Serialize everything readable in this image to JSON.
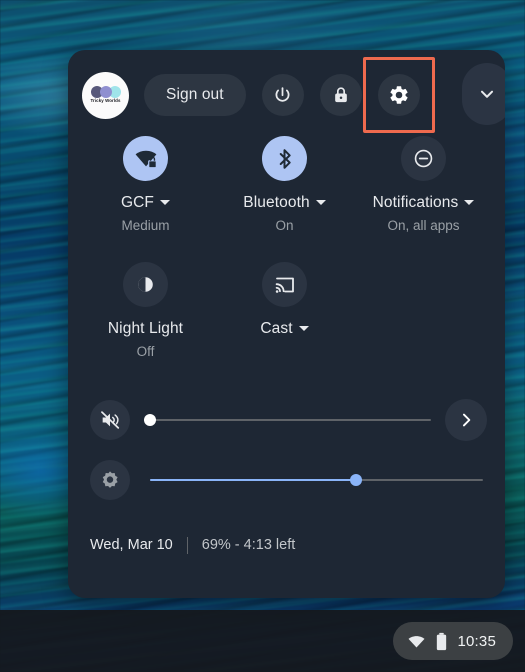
{
  "wallpaper": {
    "name": "peacock-feather-wallpaper",
    "dominant_colors": [
      "#0b5a80",
      "#0a5d6e",
      "#0d3f86"
    ]
  },
  "tray": {
    "background_color": "#1e2734",
    "header": {
      "avatar": {
        "name": "Tricky Worlds",
        "icon": "profile-avatar"
      },
      "sign_out_label": "Sign out",
      "buttons": [
        {
          "name": "power-button",
          "icon": "power-icon"
        },
        {
          "name": "lock-button",
          "icon": "lock-icon"
        },
        {
          "name": "settings-button",
          "icon": "gear-icon",
          "highlighted": true,
          "highlight_color": "#ef6a4e"
        }
      ],
      "collapse_icon": "chevron-down-icon"
    },
    "tiles": [
      {
        "id": "network",
        "icon": "wifi-locked-icon",
        "label": "GCF",
        "sublabel": "Medium",
        "has_caret": true,
        "active": true
      },
      {
        "id": "bluetooth",
        "icon": "bluetooth-icon",
        "label": "Bluetooth",
        "sublabel": "On",
        "has_caret": true,
        "active": true
      },
      {
        "id": "notifications",
        "icon": "do-not-disturb-icon",
        "label": "Notifications",
        "sublabel": "On, all apps",
        "has_caret": true,
        "active": false
      },
      {
        "id": "night-light",
        "icon": "night-light-icon",
        "label": "Night Light",
        "sublabel": "Off",
        "has_caret": false,
        "active": false
      },
      {
        "id": "cast",
        "icon": "cast-icon",
        "label": "Cast",
        "sublabel": "",
        "has_caret": true,
        "active": false
      }
    ],
    "sliders": {
      "volume": {
        "icon": "volume-muted-icon",
        "value": 0,
        "muted": true,
        "thumb_color": "#ffffff",
        "track_color": "#5f6368",
        "next_icon": "chevron-right-icon"
      },
      "brightness": {
        "icon": "brightness-icon",
        "value": 62,
        "thumb_color": "#8ab4f8",
        "fill_color": "#8ab4f8",
        "track_color": "#5f6368"
      }
    },
    "footer": {
      "date": "Wed, Mar 10",
      "battery": "69% - 4:13 left"
    }
  },
  "shelf": {
    "status_pill": {
      "wifi_icon": "wifi-icon",
      "battery_icon": "battery-icon",
      "clock": "10:35"
    }
  }
}
